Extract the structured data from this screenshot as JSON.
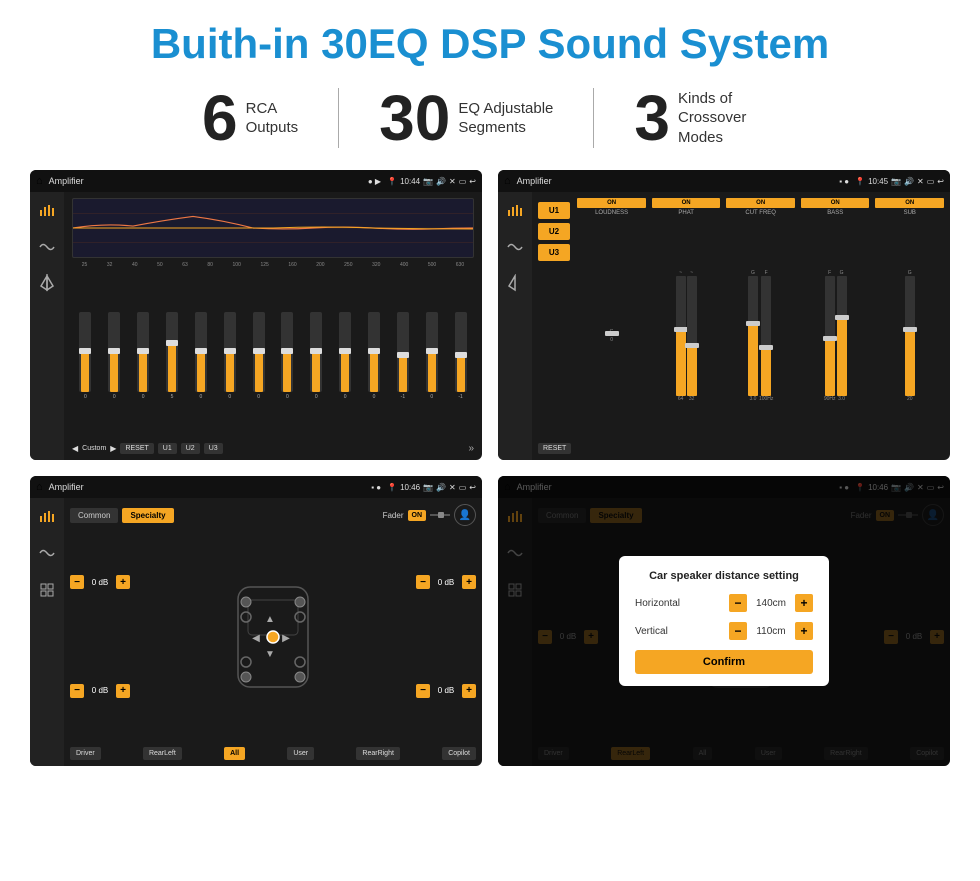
{
  "header": {
    "title": "Buith-in 30EQ DSP Sound System"
  },
  "stats": [
    {
      "number": "6",
      "label": "RCA\nOutputs"
    },
    {
      "number": "30",
      "label": "EQ Adjustable\nSegments"
    },
    {
      "number": "3",
      "label": "Kinds of\nCrossover Modes"
    }
  ],
  "screens": {
    "eq": {
      "status": {
        "title": "Amplifier",
        "time": "10:44"
      },
      "frequencies": [
        "25",
        "32",
        "40",
        "50",
        "63",
        "80",
        "100",
        "125",
        "160",
        "200",
        "250",
        "320",
        "400",
        "500",
        "630"
      ],
      "values": [
        "0",
        "0",
        "0",
        "5",
        "0",
        "0",
        "0",
        "0",
        "0",
        "0",
        "0",
        "-1",
        "0",
        "-1"
      ],
      "preset": "Custom",
      "buttons": [
        "RESET",
        "U1",
        "U2",
        "U3"
      ]
    },
    "crossover": {
      "status": {
        "title": "Amplifier",
        "time": "10:45"
      },
      "presets": [
        "U1",
        "U2",
        "U3"
      ],
      "channels": [
        {
          "label": "LOUDNESS",
          "on": true
        },
        {
          "label": "PHAT",
          "on": true
        },
        {
          "label": "CUT FREQ",
          "on": true
        },
        {
          "label": "BASS",
          "on": true
        },
        {
          "label": "SUB",
          "on": true
        }
      ],
      "reset": "RESET"
    },
    "speaker": {
      "status": {
        "title": "Amplifier",
        "time": "10:46"
      },
      "tabs": [
        "Common",
        "Specialty"
      ],
      "activeTab": "Specialty",
      "fader": "Fader",
      "faderOn": "ON",
      "volumes": [
        "0 dB",
        "0 dB",
        "0 dB",
        "0 dB"
      ],
      "buttons": [
        "Driver",
        "RearLeft",
        "All",
        "User",
        "RearRight",
        "Copilot"
      ]
    },
    "distance": {
      "status": {
        "title": "Amplifier",
        "time": "10:46"
      },
      "tabs": [
        "Common",
        "Specialty"
      ],
      "activeTab": "Common",
      "modal": {
        "title": "Car speaker distance setting",
        "horizontal_label": "Horizontal",
        "horizontal_value": "140cm",
        "vertical_label": "Vertical",
        "vertical_value": "110cm",
        "confirm_label": "Confirm"
      },
      "volumes": [
        "0 dB",
        "0 dB"
      ],
      "buttons": [
        "Driver",
        "RearLeft",
        "All",
        "User",
        "RearRight",
        "Copilot"
      ]
    }
  }
}
